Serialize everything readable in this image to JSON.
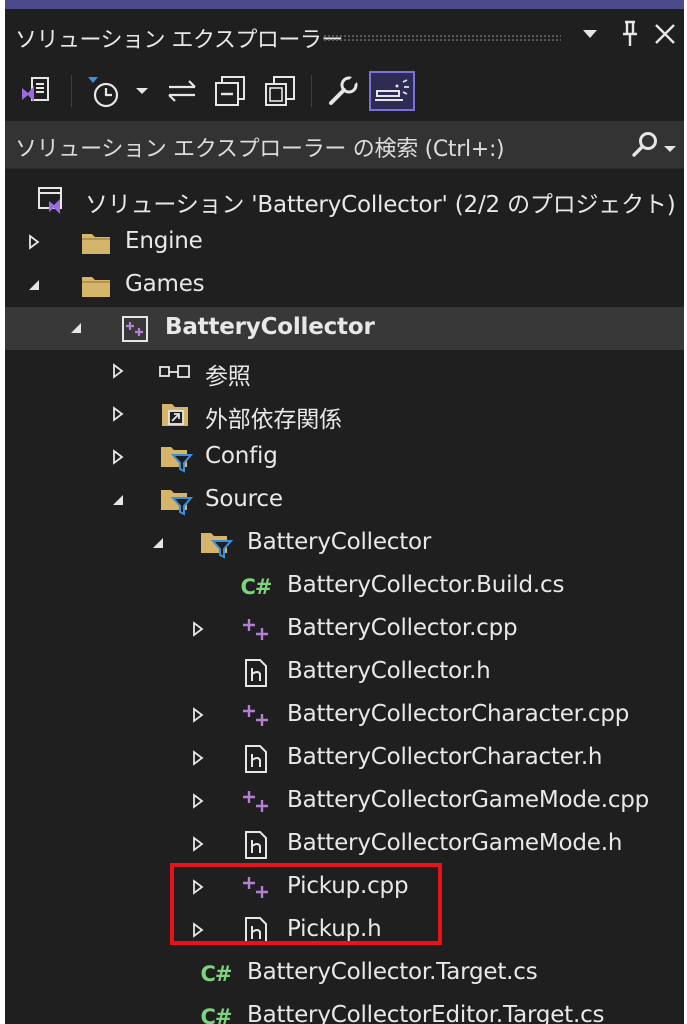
{
  "title": "ソリューション エクスプローラー",
  "search": {
    "placeholder": "ソリューション エクスプローラー の検索 (Ctrl+:)"
  },
  "tree": {
    "solution": "ソリューション 'BatteryCollector' (2/2 のプロジェクト)",
    "engine": "Engine",
    "games": "Games",
    "project": "BatteryCollector",
    "references": "参照",
    "external_deps": "外部依存関係",
    "config": "Config",
    "source": "Source",
    "source_folder": "BatteryCollector",
    "files": {
      "build_cs": "BatteryCollector.Build.cs",
      "cpp": "BatteryCollector.cpp",
      "h": "BatteryCollector.h",
      "character_cpp": "BatteryCollectorCharacter.cpp",
      "character_h": "BatteryCollectorCharacter.h",
      "gamemode_cpp": "BatteryCollectorGameMode.cpp",
      "gamemode_h": "BatteryCollectorGameMode.h",
      "pickup_cpp": "Pickup.cpp",
      "pickup_h": "Pickup.h",
      "target_cs": "BatteryCollector.Target.cs",
      "editor_target_cs": "BatteryCollectorEditor.Target.cs"
    }
  },
  "icons": {
    "cs_glyph": "C#",
    "cpp_glyph": "++",
    "h_glyph": "h"
  },
  "colors": {
    "accent": "#4c4a8a",
    "highlight": "#e8121b",
    "cs": "#7ed37e",
    "cpp": "#b57fd4",
    "folder": "#d4b56a",
    "filter": "#3d8fdc"
  }
}
